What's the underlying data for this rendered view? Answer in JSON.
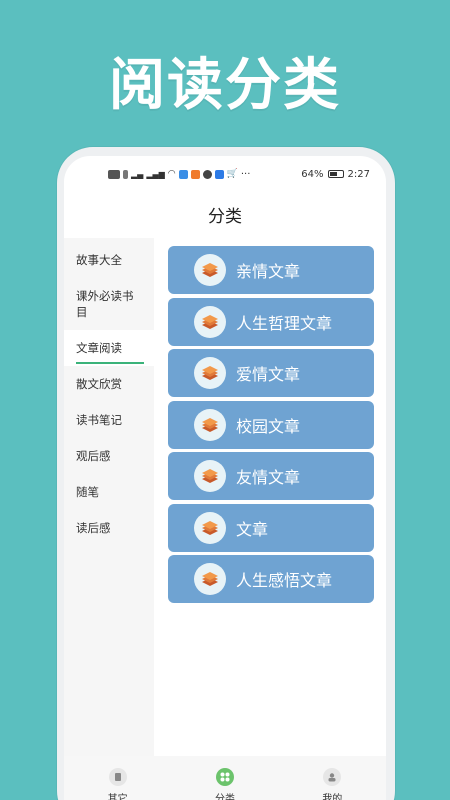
{
  "promo": {
    "title": "阅读分类"
  },
  "status_bar": {
    "battery": "64%",
    "time": "2:27",
    "battery_level": 0.64
  },
  "header": {
    "title": "分类"
  },
  "sidebar": {
    "items": [
      {
        "label": "故事大全",
        "active": false
      },
      {
        "label": "课外必读书目",
        "active": false
      },
      {
        "label": "文章阅读",
        "active": true
      },
      {
        "label": "散文欣赏",
        "active": false
      },
      {
        "label": "读书笔记",
        "active": false
      },
      {
        "label": "观后感",
        "active": false
      },
      {
        "label": "随笔",
        "active": false
      },
      {
        "label": "读后感",
        "active": false
      }
    ]
  },
  "categories": [
    {
      "label": "亲情文章"
    },
    {
      "label": "人生哲理文章"
    },
    {
      "label": "爱情文章"
    },
    {
      "label": "校园文章"
    },
    {
      "label": "友情文章"
    },
    {
      "label": "文章"
    },
    {
      "label": "人生感悟文章"
    }
  ],
  "tabbar": {
    "items": [
      {
        "label": "其它",
        "icon": "other-icon"
      },
      {
        "label": "分类",
        "icon": "category-icon"
      },
      {
        "label": "我的",
        "icon": "profile-icon"
      }
    ]
  },
  "colors": {
    "background": "#5bbfbf",
    "card": "#6fa3d2",
    "active_underline": "#3bb37a",
    "active_tab": "#6cc36c"
  }
}
